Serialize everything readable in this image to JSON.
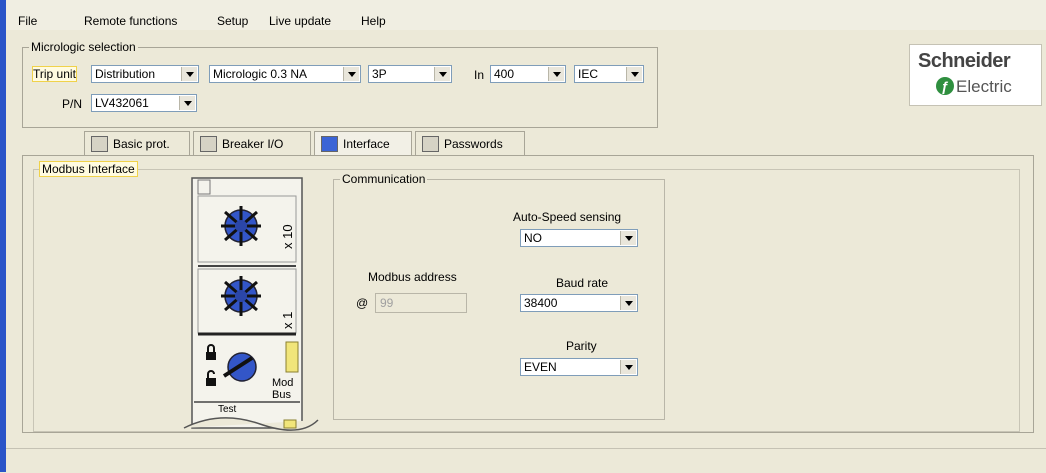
{
  "menu": {
    "file": "File",
    "remote": "Remote functions",
    "setup": "Setup",
    "live": "Live update",
    "help": "Help"
  },
  "selection": {
    "legend": "Micrologic selection",
    "trip_unit_label": "Trip unit",
    "trip_unit_value": "Distribution",
    "micrologic_value": "Micrologic 0.3 NA",
    "poles_value": "3P",
    "in_label": "In",
    "in_value": "400",
    "standard_value": "IEC",
    "pn_label": "P/N",
    "pn_value": "LV432061"
  },
  "logo": {
    "line1": "Schneider",
    "line2": "Electric"
  },
  "tabs": [
    {
      "label": "Basic prot."
    },
    {
      "label": "Breaker I/O"
    },
    {
      "label": "Interface"
    },
    {
      "label": "Passwords"
    }
  ],
  "modbus": {
    "legend": "Modbus Interface",
    "dial_labels": {
      "x10": "x 10",
      "x1": "x 1",
      "bus1": "Mod",
      "bus2": "Bus",
      "test": "Test"
    }
  },
  "comm": {
    "legend": "Communication",
    "autospeed_label": "Auto-Speed sensing",
    "autospeed_value": "NO",
    "address_label": "Modbus address",
    "at_symbol": "@",
    "address_value": "99",
    "baud_label": "Baud rate",
    "baud_value": "38400",
    "parity_label": "Parity",
    "parity_value": "EVEN"
  },
  "colors": {
    "accent": "#2a54c8",
    "background": "#ece9d8",
    "highlight": "#f0d24a"
  }
}
